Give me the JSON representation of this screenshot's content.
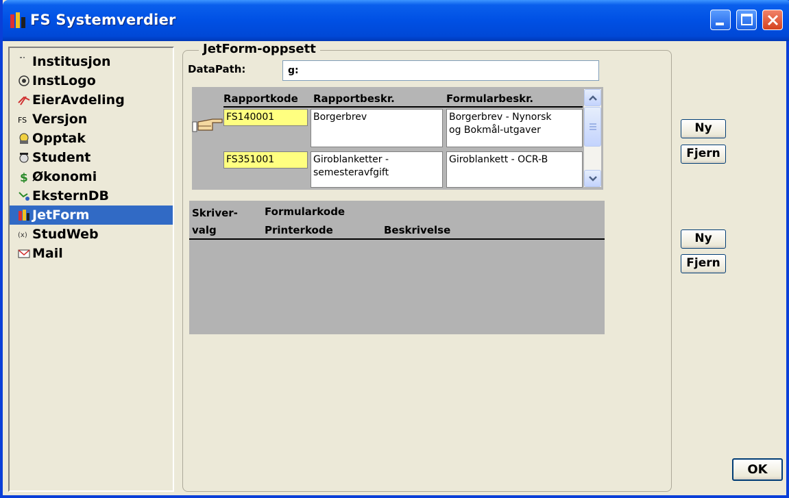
{
  "window": {
    "title": "FS Systemverdier"
  },
  "titlebar_buttons": [
    "minimize",
    "maximize",
    "close"
  ],
  "nav": {
    "selected": "JetForm",
    "items": [
      {
        "label": "Institusjon",
        "icon": "institution-icon"
      },
      {
        "label": "InstLogo",
        "icon": "logo-icon"
      },
      {
        "label": "EierAvdeling",
        "icon": "department-icon"
      },
      {
        "label": "Versjon",
        "icon": "version-fs-icon"
      },
      {
        "label": "Opptak",
        "icon": "admission-icon"
      },
      {
        "label": "Student",
        "icon": "student-icon"
      },
      {
        "label": "Økonomi",
        "icon": "dollar-icon"
      },
      {
        "label": "EksternDB",
        "icon": "external-db-icon"
      },
      {
        "label": "JetForm",
        "icon": "jetform-icon"
      },
      {
        "label": "StudWeb",
        "icon": "studweb-icon"
      },
      {
        "label": "Mail",
        "icon": "mail-icon"
      }
    ]
  },
  "group": {
    "title": "JetForm-oppsett"
  },
  "datapath": {
    "label": "DataPath:",
    "value": "g:"
  },
  "report_table": {
    "headers": [
      "Rapportkode",
      "Rapportbeskr.",
      "Formularbeskr."
    ],
    "rows": [
      {
        "code": "FS140001",
        "desc1": "Borgerbrev",
        "desc2a": "",
        "form1": "Borgerbrev - Nynorsk",
        "form2": "og Bokmål-utgaver",
        "current": true
      },
      {
        "code": "FS351001",
        "desc1": "Giroblanketter -",
        "desc2a": "semesteravfgift",
        "form1": "Giroblankett - OCR-B",
        "form2": "",
        "current": false
      }
    ]
  },
  "printer_table": {
    "headers": {
      "col1_line1": "Skriver-",
      "col1_line2": "valg",
      "col2_line1": "Formularkode",
      "col2_line2": "Printerkode",
      "col3": "Beskrivelse"
    }
  },
  "buttons": {
    "ny1": "Ny",
    "fjern1": "Fjern",
    "ny2": "Ny",
    "fjern2": "Fjern",
    "ok": "OK"
  },
  "colors": {
    "title_bar": "#0050e4",
    "selection": "#316ac5",
    "key_cell": "#ffff80",
    "grid_bg": "#b5b5b5"
  }
}
